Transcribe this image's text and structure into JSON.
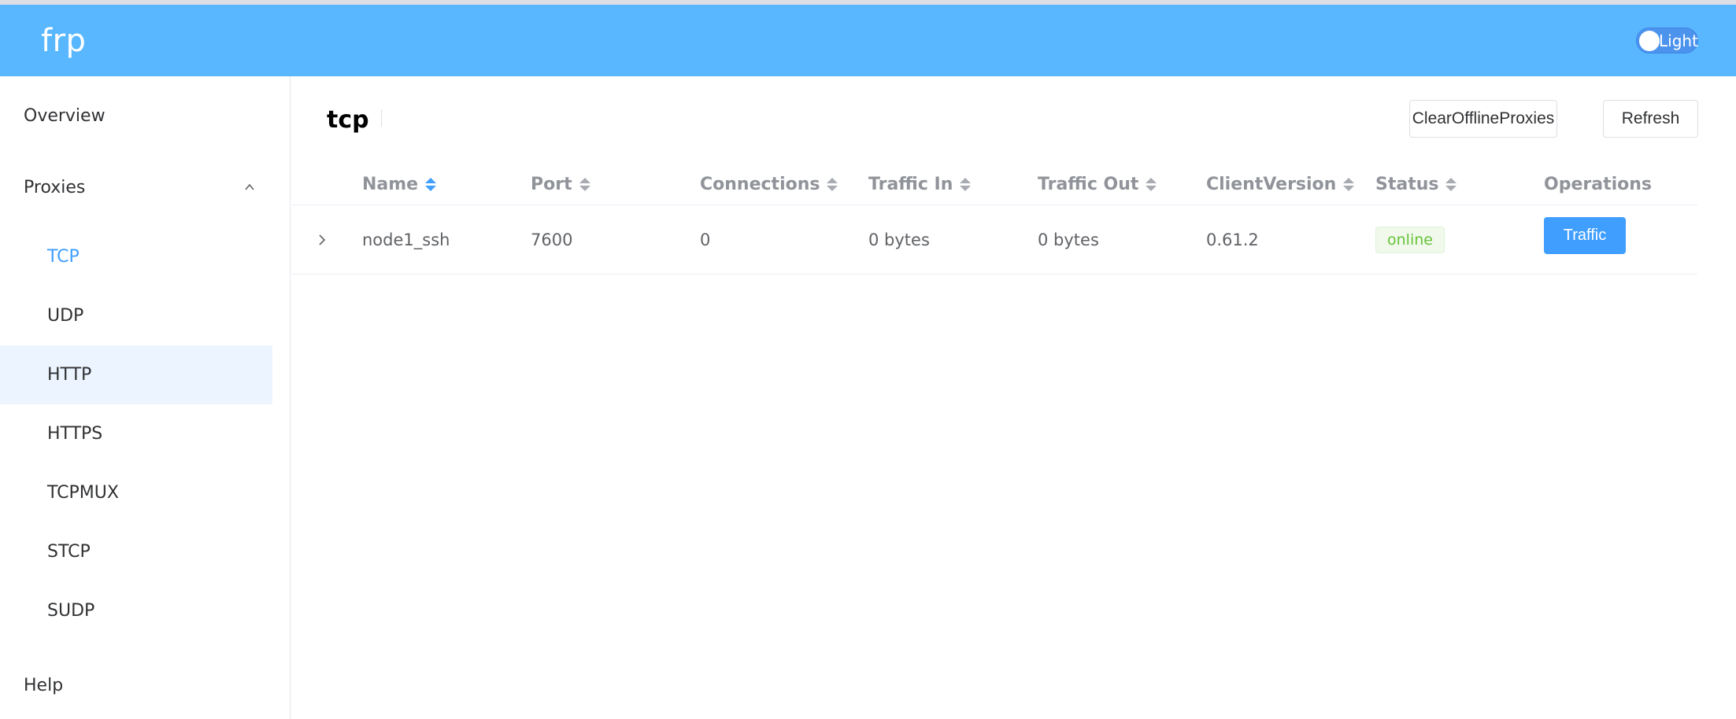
{
  "header": {
    "brand": "frp",
    "theme_label": "Light"
  },
  "sidebar": {
    "overview": "Overview",
    "proxies": "Proxies",
    "proxy_types": [
      "TCP",
      "UDP",
      "HTTP",
      "HTTPS",
      "TCPMUX",
      "STCP",
      "SUDP"
    ],
    "help": "Help",
    "active_item": "TCP",
    "hover_item": "HTTP"
  },
  "main": {
    "title": "tcp",
    "clear_button": "ClearOfflineProxies",
    "refresh_button": "Refresh"
  },
  "table": {
    "columns": [
      "Name",
      "Port",
      "Connections",
      "Traffic In",
      "Traffic Out",
      "ClientVersion",
      "Status",
      "Operations"
    ],
    "rows": [
      {
        "name": "node1_ssh",
        "port": "7600",
        "connections": "0",
        "traffic_in": "0 bytes",
        "traffic_out": "0 bytes",
        "client_version": "0.61.2",
        "status": "online",
        "operation": "Traffic"
      }
    ]
  },
  "colors": {
    "header_bg": "#58b7ff",
    "accent": "#409eff",
    "online_text": "#67c23a",
    "menu_hover_bg": "#ecf5ff"
  }
}
